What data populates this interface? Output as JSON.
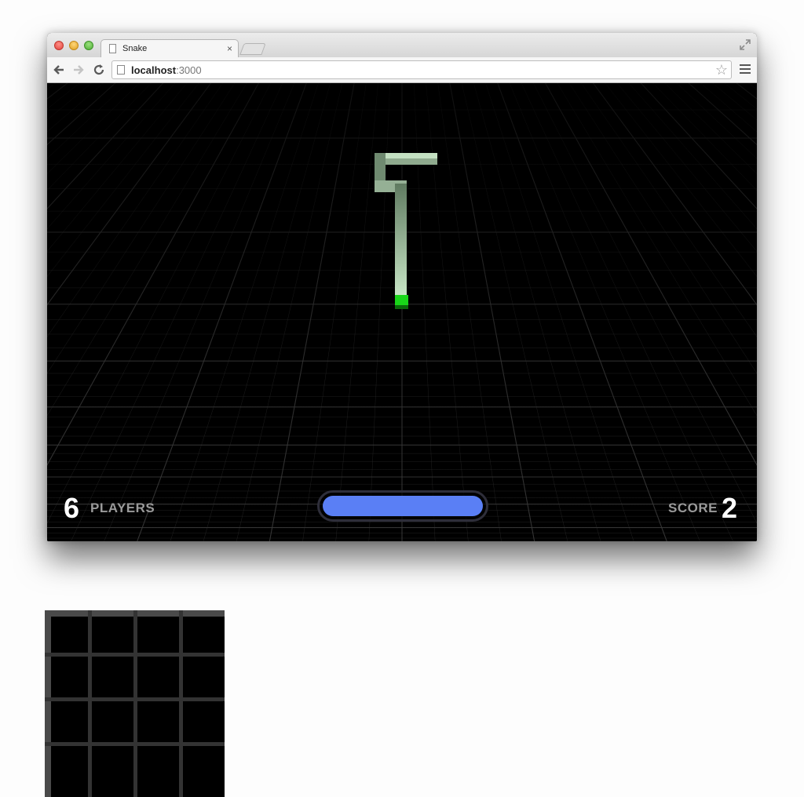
{
  "browser": {
    "tab_title": "Snake",
    "tab_close": "×",
    "url_host": "localhost",
    "url_port": ":3000",
    "bookmark_star": "☆"
  },
  "game": {
    "players_count": "6",
    "players_label": "PLAYERS",
    "score_label": "SCORE",
    "score_value": "2",
    "boost_level": 1.0,
    "colors": {
      "background": "#000000",
      "grid_line": "#3a3a3a",
      "snake_body": "#b9d9b7",
      "snake_head": "#19d619",
      "boost": "#5a7ff5"
    }
  }
}
